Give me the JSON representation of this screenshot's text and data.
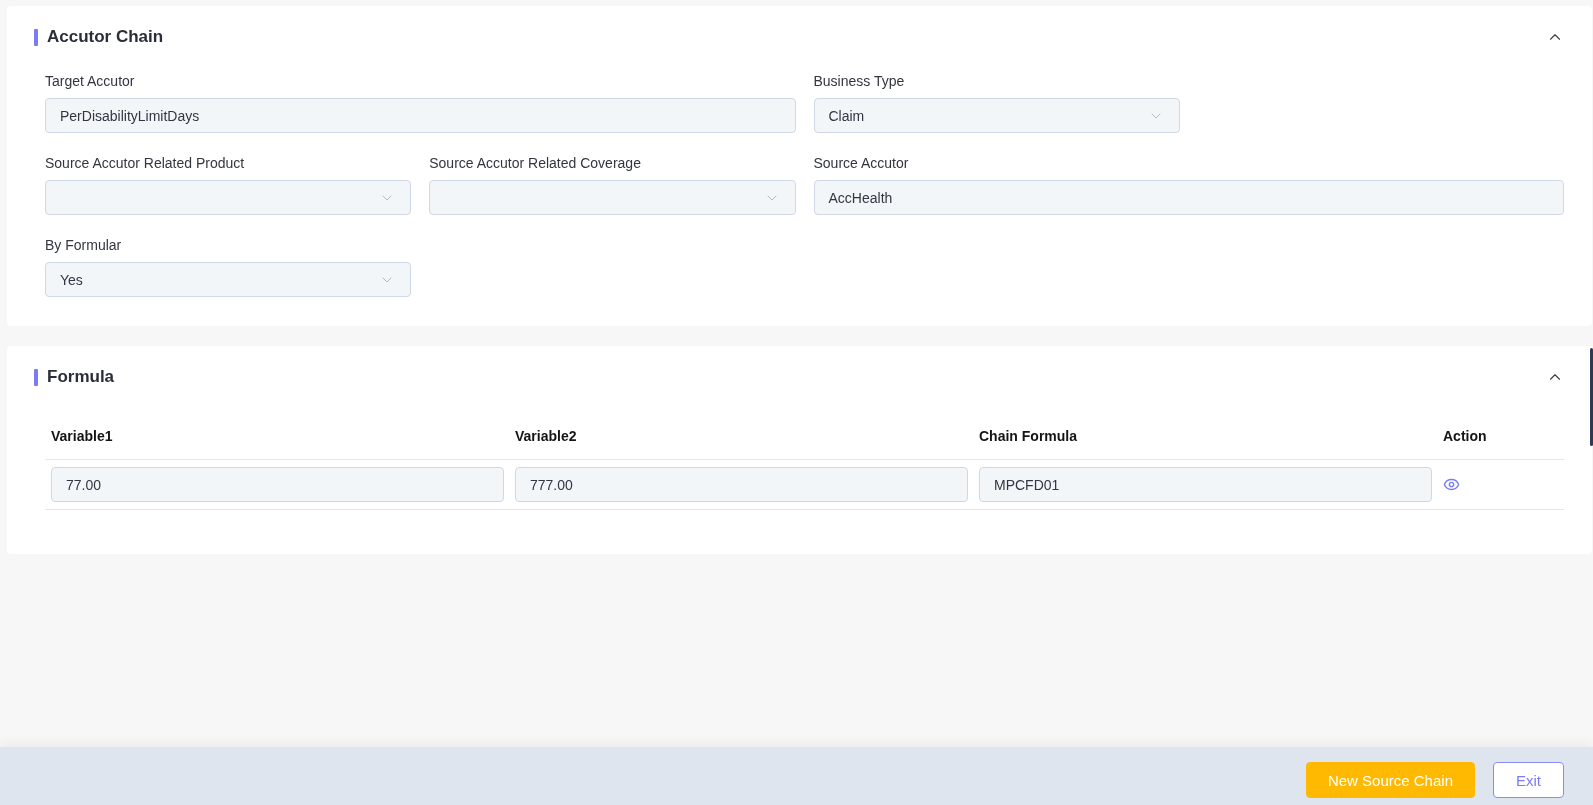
{
  "sections": [
    {
      "kind": "form",
      "title": "Accutor Chain",
      "expanded": true,
      "rows": [
        [
          {
            "fields": [
              {
                "label": "Target Accutor",
                "kind": "text",
                "value": "PerDisabilityLimitDays"
              }
            ]
          },
          {
            "fields": [
              {
                "label": "Business Type",
                "kind": "select",
                "value": "Claim"
              }
            ]
          }
        ],
        [
          {
            "fields": [
              {
                "label": "Source Accutor Related Product",
                "kind": "select"
              },
              {
                "label": "Source Accutor Related Coverage",
                "kind": "select"
              }
            ]
          },
          {
            "fields": [
              {
                "label": "Source Accutor",
                "kind": "text",
                "value": "AccHealth"
              }
            ]
          }
        ],
        [
          {
            "fields": [
              {
                "label": "By Formular",
                "kind": "select",
                "value": "Yes"
              }
            ]
          }
        ]
      ]
    },
    {
      "kind": "table",
      "title": "Formula",
      "expanded": true,
      "columns": [
        "Variable1",
        "Variable2",
        "Chain Formula",
        "Action"
      ],
      "rows": [
        {
          "cells": [
            "77.00",
            "777.00",
            "MPCFD01"
          ]
        }
      ]
    }
  ],
  "footer": {
    "buttons": [
      {
        "label": "New Source Chain",
        "kind": "primary"
      },
      {
        "label": "Exit",
        "kind": "outline"
      }
    ]
  }
}
